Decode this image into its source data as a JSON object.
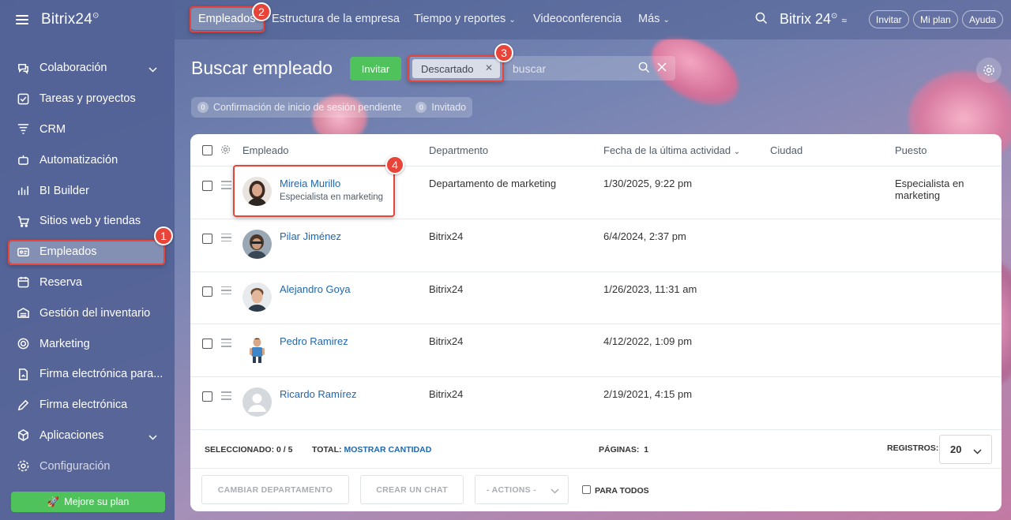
{
  "sidebar": {
    "logo": "Bitrix24",
    "items": [
      {
        "label": "Colaboración",
        "icon": "chat-bubbles-icon",
        "expandable": true
      },
      {
        "label": "Tareas y proyectos",
        "icon": "checkbox-icon"
      },
      {
        "label": "CRM",
        "icon": "funnel-icon"
      },
      {
        "label": "Automatización",
        "icon": "robot-icon"
      },
      {
        "label": "BI Builder",
        "icon": "bar-chart-icon"
      },
      {
        "label": "Sitios web y tiendas",
        "icon": "cart-icon"
      },
      {
        "label": "Empleados",
        "icon": "id-card-icon",
        "active": true
      },
      {
        "label": "Reserva",
        "icon": "calendar-icon"
      },
      {
        "label": "Gestión del inventario",
        "icon": "warehouse-icon"
      },
      {
        "label": "Marketing",
        "icon": "target-icon"
      },
      {
        "label": "Firma electrónica para...",
        "icon": "document-sign-icon"
      },
      {
        "label": "Firma electrónica",
        "icon": "pen-icon"
      },
      {
        "label": "Aplicaciones",
        "icon": "cube-icon",
        "expandable": true
      },
      {
        "label": "Configuración",
        "icon": "gear-icon"
      }
    ],
    "upgrade_label": "Mejore su plan"
  },
  "topnav": {
    "items": [
      "Empleados",
      "Estructura de la empresa",
      "Tiempo y reportes",
      "Videoconferencia",
      "Más"
    ],
    "brand": "Bitrix 24",
    "buttons": [
      "Invitar",
      "Mi plan",
      "Ayuda"
    ]
  },
  "page": {
    "title": "Buscar empleado",
    "invite_label": "Invitar",
    "filter_tag": "Descartado",
    "search_placeholder": "buscar",
    "counters": [
      {
        "count": "0",
        "label": "Confirmación de inicio de sesión pendiente"
      },
      {
        "count": "0",
        "label": "Invitado"
      }
    ]
  },
  "grid": {
    "columns": [
      "Empleado",
      "Departmento",
      "Fecha de la última actividad",
      "Ciudad",
      "Puesto"
    ],
    "rows": [
      {
        "name": "Mireia Murillo",
        "subtitle": "Especialista en marketing",
        "department": "Departamento de marketing",
        "last_activity": "1/30/2025, 9:22 pm",
        "city": "",
        "position_line1": "Especialista en",
        "position_line2": "marketing"
      },
      {
        "name": "Pilar Jiménez",
        "subtitle": "",
        "department": "Bitrix24",
        "last_activity": "6/4/2024, 2:37 pm",
        "city": "",
        "position_line1": "",
        "position_line2": ""
      },
      {
        "name": "Alejandro Goya",
        "subtitle": "",
        "department": "Bitrix24",
        "last_activity": "1/26/2023, 11:31 am",
        "city": "",
        "position_line1": "",
        "position_line2": ""
      },
      {
        "name": "Pedro Ramirez",
        "subtitle": "",
        "department": "Bitrix24",
        "last_activity": "4/12/2022, 1:09 pm",
        "city": "",
        "position_line1": "",
        "position_line2": ""
      },
      {
        "name": "Ricardo Ramírez",
        "subtitle": "",
        "department": "Bitrix24",
        "last_activity": "2/19/2021, 4:15 pm",
        "city": "",
        "position_line1": "",
        "position_line2": ""
      }
    ],
    "footer": {
      "selected_label": "SELECCIONADO:",
      "selected_value": "0 / 5",
      "total_label": "TOTAL:",
      "total_link": "MOSTRAR CANTIDAD",
      "pages_label": "PÁGINAS:",
      "pages_value": "1",
      "records_label": "REGISTROS:",
      "records_value": "20"
    },
    "actions": {
      "change_department": "CAMBIAR DEPARTAMENTO",
      "create_chat": "CREAR UN CHAT",
      "actions_select": "- ACTIONS -",
      "for_all": "PARA TODOS"
    }
  },
  "callouts": [
    "1",
    "2",
    "3",
    "4"
  ],
  "colors": {
    "accent_green": "#4fc25c",
    "callout_red": "#e8443a",
    "link_blue": "#2067b0"
  }
}
